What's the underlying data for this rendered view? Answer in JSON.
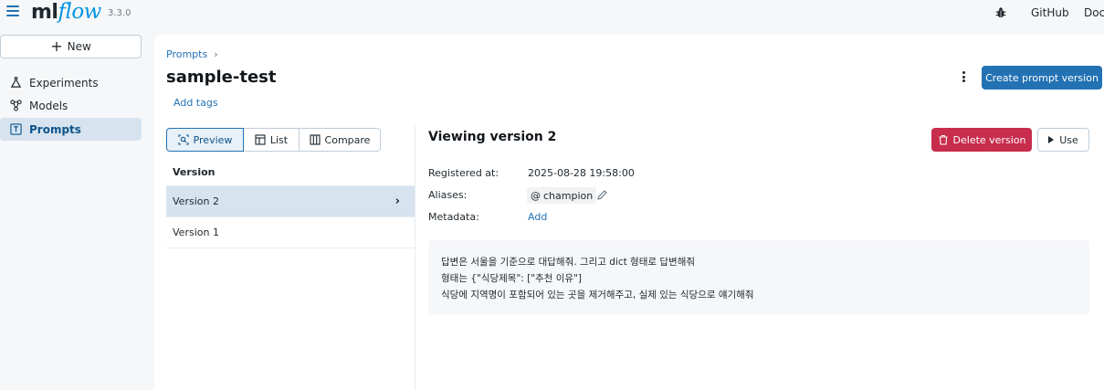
{
  "topbar": {
    "logo_main": "ml",
    "logo_flow": "flow",
    "version": "3.3.0",
    "links": [
      "GitHub",
      "Docs"
    ],
    "icons": {
      "menu": "hamburger-icon",
      "bug": "bug-icon"
    }
  },
  "sidebar": {
    "new_label": "New",
    "items": [
      {
        "label": "Experiments",
        "icon": "flask-icon",
        "active": false
      },
      {
        "label": "Models",
        "icon": "models-icon",
        "active": false
      },
      {
        "label": "Prompts",
        "icon": "prompt-icon",
        "active": true
      }
    ]
  },
  "header": {
    "breadcrumb": [
      "Prompts"
    ],
    "breadcrumb_sep": "›",
    "title": "sample-test",
    "add_tags": "Add tags",
    "create_button": "Create prompt version"
  },
  "view_modes": [
    {
      "label": "Preview",
      "icon": "preview-icon",
      "active": true
    },
    {
      "label": "List",
      "icon": "table-icon",
      "active": false
    },
    {
      "label": "Compare",
      "icon": "columns-icon",
      "active": false
    }
  ],
  "versions": {
    "header": "Version",
    "rows": [
      {
        "label": "Version 2",
        "selected": true
      },
      {
        "label": "Version 1",
        "selected": false
      }
    ],
    "chevron": "›"
  },
  "detail": {
    "title": "Viewing version 2",
    "delete_button": "Delete version",
    "use_button": "Use",
    "registered_label": "Registered at:",
    "registered_value": "2025-08-28 19:58:00",
    "aliases_label": "Aliases:",
    "alias": "champion",
    "alias_prefix": "@",
    "metadata_label": "Metadata:",
    "metadata_add": "Add",
    "prompt_lines": [
      "답변은 서울을 기준으로 대답해줘. 그리고 dict 형태로 답변해줘",
      "형태는 {\"식당제목\": [\"추천 이유\"]",
      "식당에 지역명이 포함되어 있는 곳을 제거해주고, 실제 있는 식당으로 얘기해줘"
    ]
  },
  "colors": {
    "primary": "#2272b4",
    "danger": "#c82d4c",
    "selected_bg": "#d7e4ef",
    "logo_flow": "#0194e2"
  }
}
